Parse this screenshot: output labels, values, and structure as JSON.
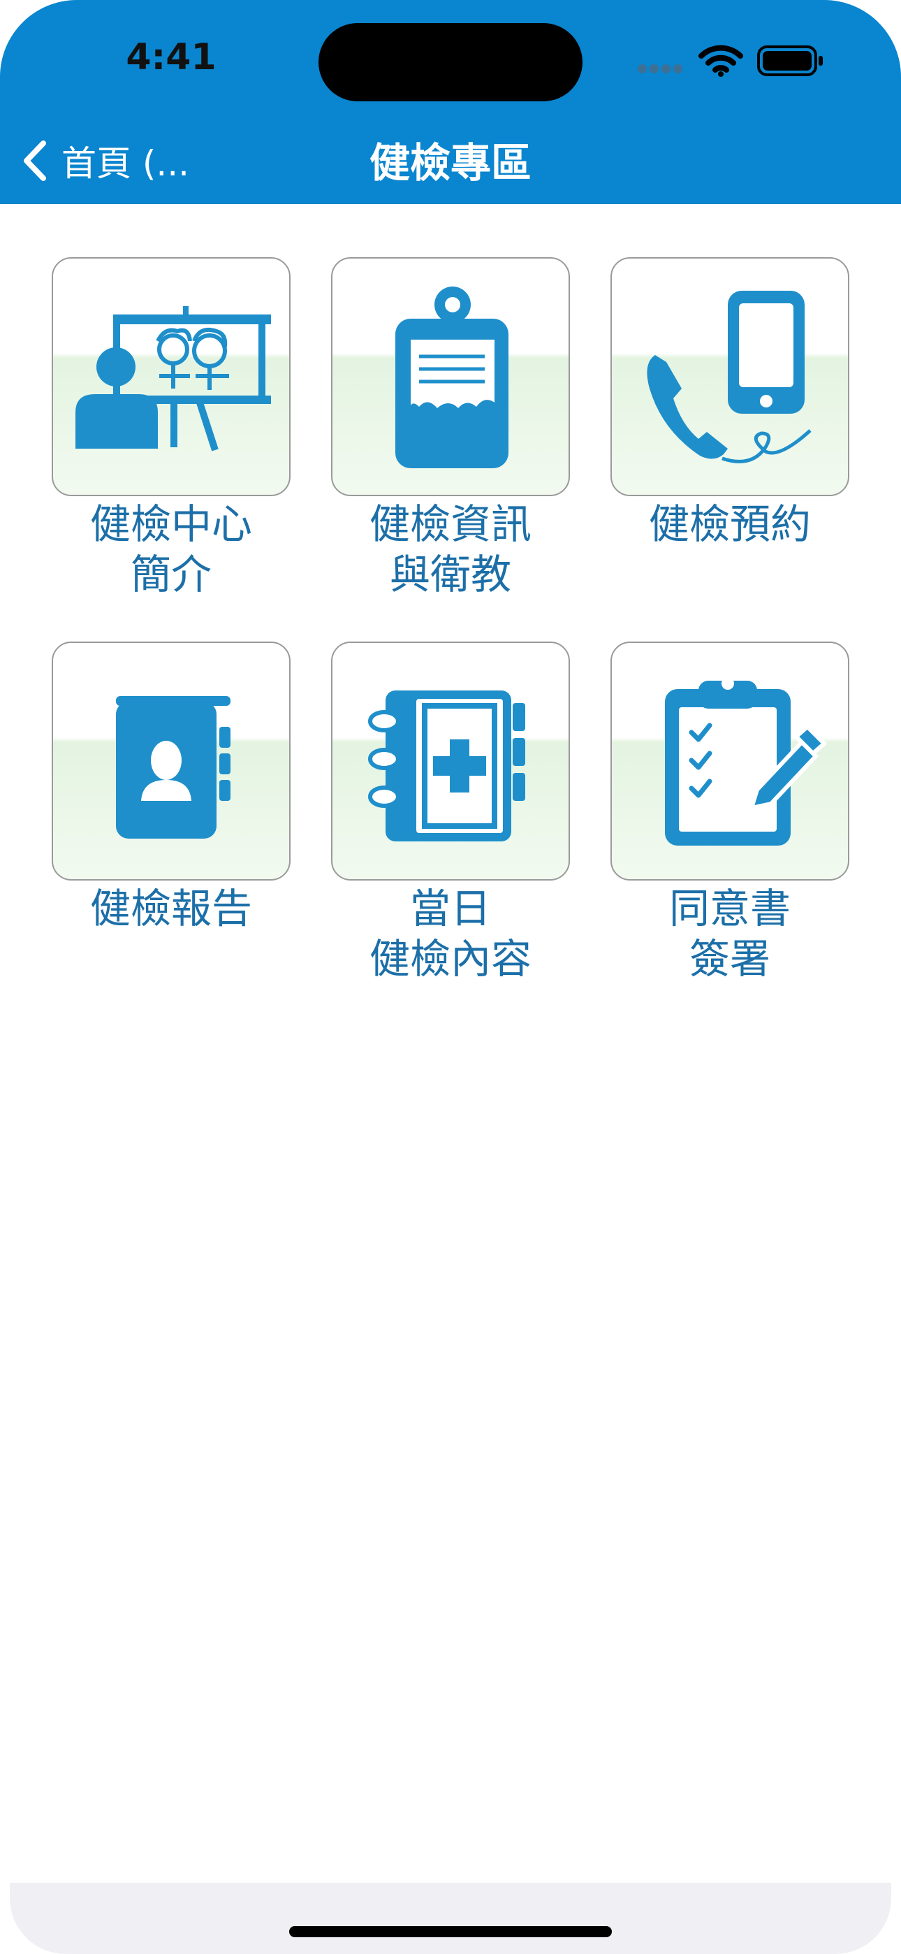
{
  "status_bar": {
    "time": "4:41",
    "icons": [
      "cellular-icon",
      "wifi-icon",
      "battery-icon"
    ]
  },
  "nav": {
    "back_label": "首頁 (...",
    "title": "健檢專區",
    "back_icon": "chevron-left-icon"
  },
  "tiles": [
    {
      "label": "健檢中心\n簡介",
      "icon": "presentation-board-icon"
    },
    {
      "label": "健檢資訊\n與衛教",
      "icon": "clipboard-icon"
    },
    {
      "label": "健檢預約",
      "icon": "phone-booking-icon"
    },
    {
      "label": "健檢報告",
      "icon": "contact-book-icon"
    },
    {
      "label": "當日\n健檢內容",
      "icon": "medical-notebook-icon"
    },
    {
      "label": "同意書\n簽署",
      "icon": "checklist-sign-icon"
    }
  ],
  "colors": {
    "header": "#0a85cf",
    "icon_blue": "#1e8fcb",
    "label_blue": "#1c6fa8",
    "tile_green": "#e4f4e1",
    "bottom_bar": "#efeff4"
  }
}
